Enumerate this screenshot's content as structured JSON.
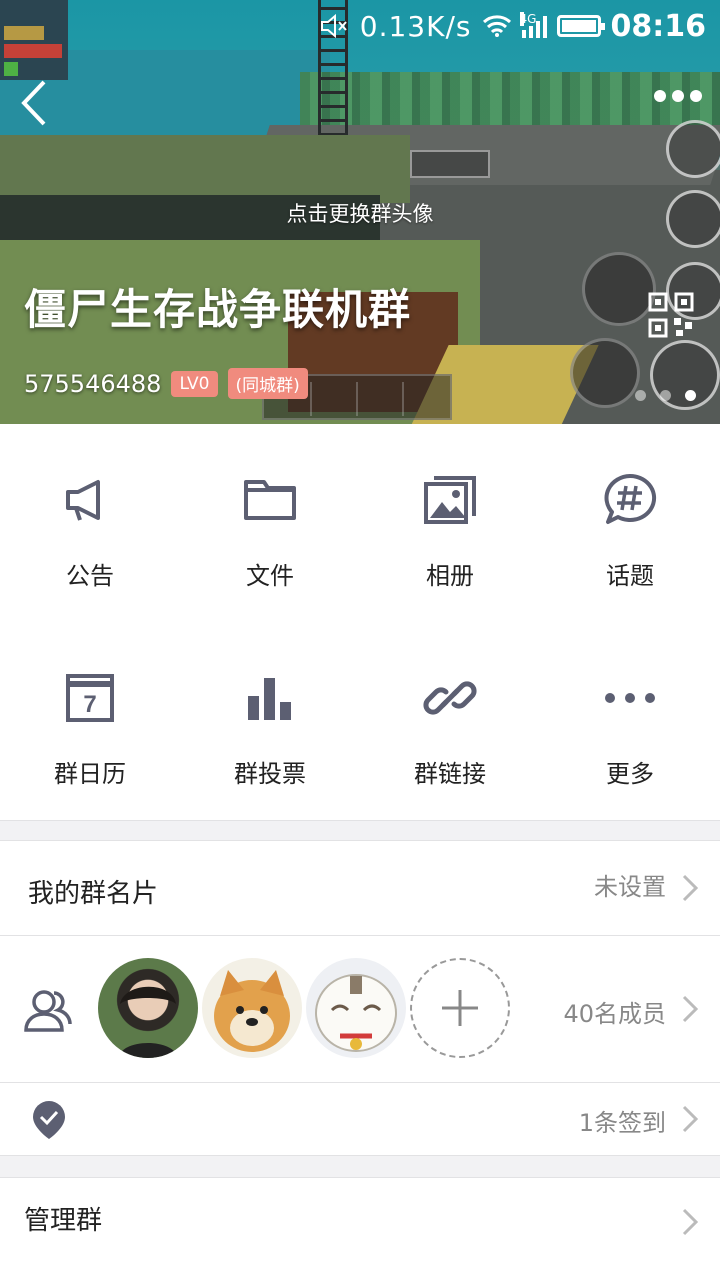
{
  "status_bar": {
    "net_speed": "0.13K/s",
    "network": "4G",
    "time": "08:16"
  },
  "header": {
    "change_avatar_hint": "点击更换群头像",
    "group_name": "僵尸生存战争联机群",
    "group_id": "575546488",
    "level_tag": "LV0",
    "city_tag": "(同城群)",
    "pager": {
      "total": 3,
      "active": 3
    }
  },
  "grid": [
    {
      "label": "公告",
      "icon": "megaphone-icon"
    },
    {
      "label": "文件",
      "icon": "folder-icon"
    },
    {
      "label": "相册",
      "icon": "album-icon"
    },
    {
      "label": "话题",
      "icon": "topic-hash-icon"
    },
    {
      "label": "群日历",
      "icon": "calendar-icon",
      "day": "7"
    },
    {
      "label": "群投票",
      "icon": "bar-chart-icon"
    },
    {
      "label": "群链接",
      "icon": "link-icon"
    },
    {
      "label": "更多",
      "icon": "more-dots-icon"
    }
  ],
  "list": {
    "card": {
      "title": "我的群名片",
      "value": "未设置"
    },
    "members": {
      "value": "40名成员"
    },
    "checkin": {
      "value": "1条签到"
    },
    "manage": {
      "title": "管理群"
    }
  },
  "colors": {
    "accent_tag": "#f08b7e",
    "icon": "#5c5f72"
  }
}
